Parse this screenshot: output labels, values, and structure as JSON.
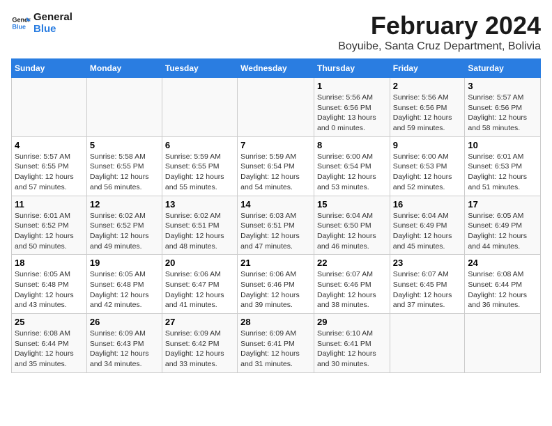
{
  "logo": {
    "line1": "General",
    "line2": "Blue"
  },
  "title": "February 2024",
  "location": "Boyuibe, Santa Cruz Department, Bolivia",
  "days_header": [
    "Sunday",
    "Monday",
    "Tuesday",
    "Wednesday",
    "Thursday",
    "Friday",
    "Saturday"
  ],
  "weeks": [
    [
      {
        "day": "",
        "info": ""
      },
      {
        "day": "",
        "info": ""
      },
      {
        "day": "",
        "info": ""
      },
      {
        "day": "",
        "info": ""
      },
      {
        "day": "1",
        "info": "Sunrise: 5:56 AM\nSunset: 6:56 PM\nDaylight: 13 hours\nand 0 minutes."
      },
      {
        "day": "2",
        "info": "Sunrise: 5:56 AM\nSunset: 6:56 PM\nDaylight: 12 hours\nand 59 minutes."
      },
      {
        "day": "3",
        "info": "Sunrise: 5:57 AM\nSunset: 6:56 PM\nDaylight: 12 hours\nand 58 minutes."
      }
    ],
    [
      {
        "day": "4",
        "info": "Sunrise: 5:57 AM\nSunset: 6:55 PM\nDaylight: 12 hours\nand 57 minutes."
      },
      {
        "day": "5",
        "info": "Sunrise: 5:58 AM\nSunset: 6:55 PM\nDaylight: 12 hours\nand 56 minutes."
      },
      {
        "day": "6",
        "info": "Sunrise: 5:59 AM\nSunset: 6:55 PM\nDaylight: 12 hours\nand 55 minutes."
      },
      {
        "day": "7",
        "info": "Sunrise: 5:59 AM\nSunset: 6:54 PM\nDaylight: 12 hours\nand 54 minutes."
      },
      {
        "day": "8",
        "info": "Sunrise: 6:00 AM\nSunset: 6:54 PM\nDaylight: 12 hours\nand 53 minutes."
      },
      {
        "day": "9",
        "info": "Sunrise: 6:00 AM\nSunset: 6:53 PM\nDaylight: 12 hours\nand 52 minutes."
      },
      {
        "day": "10",
        "info": "Sunrise: 6:01 AM\nSunset: 6:53 PM\nDaylight: 12 hours\nand 51 minutes."
      }
    ],
    [
      {
        "day": "11",
        "info": "Sunrise: 6:01 AM\nSunset: 6:52 PM\nDaylight: 12 hours\nand 50 minutes."
      },
      {
        "day": "12",
        "info": "Sunrise: 6:02 AM\nSunset: 6:52 PM\nDaylight: 12 hours\nand 49 minutes."
      },
      {
        "day": "13",
        "info": "Sunrise: 6:02 AM\nSunset: 6:51 PM\nDaylight: 12 hours\nand 48 minutes."
      },
      {
        "day": "14",
        "info": "Sunrise: 6:03 AM\nSunset: 6:51 PM\nDaylight: 12 hours\nand 47 minutes."
      },
      {
        "day": "15",
        "info": "Sunrise: 6:04 AM\nSunset: 6:50 PM\nDaylight: 12 hours\nand 46 minutes."
      },
      {
        "day": "16",
        "info": "Sunrise: 6:04 AM\nSunset: 6:49 PM\nDaylight: 12 hours\nand 45 minutes."
      },
      {
        "day": "17",
        "info": "Sunrise: 6:05 AM\nSunset: 6:49 PM\nDaylight: 12 hours\nand 44 minutes."
      }
    ],
    [
      {
        "day": "18",
        "info": "Sunrise: 6:05 AM\nSunset: 6:48 PM\nDaylight: 12 hours\nand 43 minutes."
      },
      {
        "day": "19",
        "info": "Sunrise: 6:05 AM\nSunset: 6:48 PM\nDaylight: 12 hours\nand 42 minutes."
      },
      {
        "day": "20",
        "info": "Sunrise: 6:06 AM\nSunset: 6:47 PM\nDaylight: 12 hours\nand 41 minutes."
      },
      {
        "day": "21",
        "info": "Sunrise: 6:06 AM\nSunset: 6:46 PM\nDaylight: 12 hours\nand 39 minutes."
      },
      {
        "day": "22",
        "info": "Sunrise: 6:07 AM\nSunset: 6:46 PM\nDaylight: 12 hours\nand 38 minutes."
      },
      {
        "day": "23",
        "info": "Sunrise: 6:07 AM\nSunset: 6:45 PM\nDaylight: 12 hours\nand 37 minutes."
      },
      {
        "day": "24",
        "info": "Sunrise: 6:08 AM\nSunset: 6:44 PM\nDaylight: 12 hours\nand 36 minutes."
      }
    ],
    [
      {
        "day": "25",
        "info": "Sunrise: 6:08 AM\nSunset: 6:44 PM\nDaylight: 12 hours\nand 35 minutes."
      },
      {
        "day": "26",
        "info": "Sunrise: 6:09 AM\nSunset: 6:43 PM\nDaylight: 12 hours\nand 34 minutes."
      },
      {
        "day": "27",
        "info": "Sunrise: 6:09 AM\nSunset: 6:42 PM\nDaylight: 12 hours\nand 33 minutes."
      },
      {
        "day": "28",
        "info": "Sunrise: 6:09 AM\nSunset: 6:41 PM\nDaylight: 12 hours\nand 31 minutes."
      },
      {
        "day": "29",
        "info": "Sunrise: 6:10 AM\nSunset: 6:41 PM\nDaylight: 12 hours\nand 30 minutes."
      },
      {
        "day": "",
        "info": ""
      },
      {
        "day": "",
        "info": ""
      }
    ]
  ]
}
